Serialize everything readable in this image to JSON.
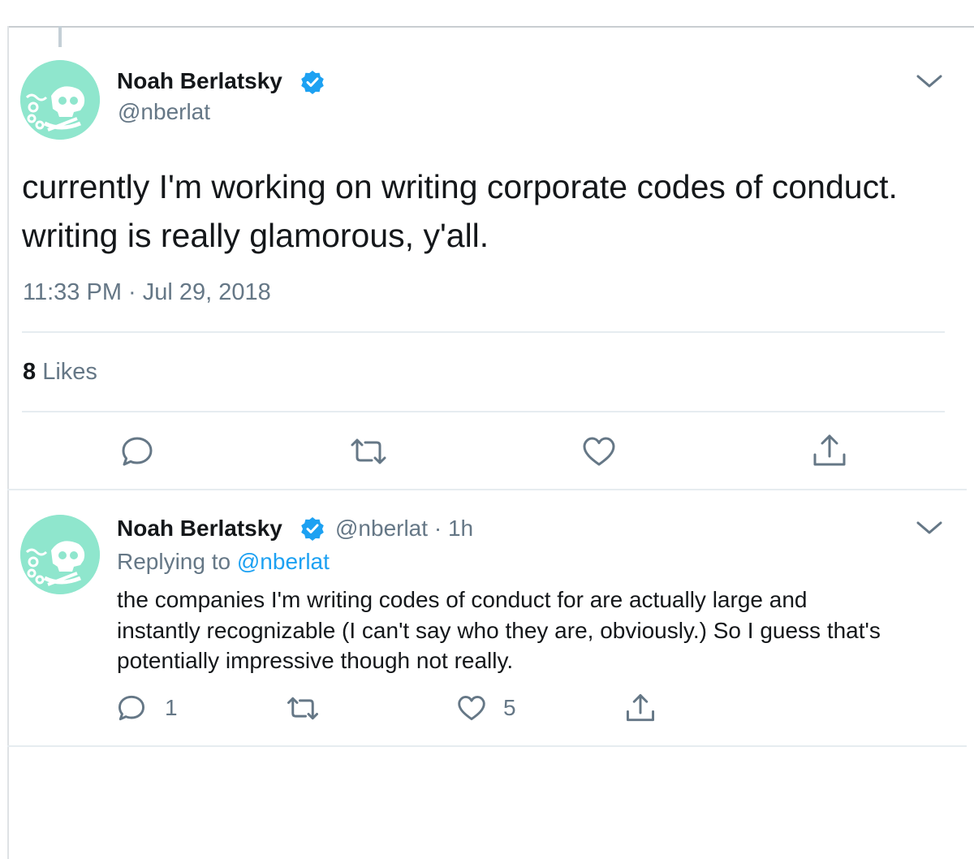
{
  "main_tweet": {
    "author_name": "Noah Berlatsky",
    "author_handle": "@nberlat",
    "text_lines": [
      "currently I'm working on writing corporate codes of conduct.",
      "writing is really glamorous, y'all."
    ],
    "time": "11:33 PM",
    "separator": "·",
    "date": "Jul 29, 2018",
    "likes_count": "8",
    "likes_label": "Likes"
  },
  "reply_tweet": {
    "author_name": "Noah Berlatsky",
    "author_handle": "@nberlat",
    "separator": "·",
    "age": "1h",
    "replying_prefix": "Replying to",
    "replying_to": "@nberlat",
    "text_lines": [
      "the companies I'm writing codes of conduct for are actually large and",
      "instantly recognizable (I can't say who they are, obviously.) So I guess that's",
      "potentially impressive though not really."
    ],
    "reply_count": "1",
    "like_count": "5"
  },
  "icons": {
    "avatar": "skull-avatar-icon",
    "verified": "verified-badge-icon",
    "menu": "chevron-down-icon",
    "reply": "reply-icon",
    "retweet": "retweet-icon",
    "like": "heart-icon",
    "share": "share-icon"
  },
  "colors": {
    "text": "#14171a",
    "secondary": "#657786",
    "accent": "#1da1f2",
    "avatar_bg": "#8fe6cd",
    "divider": "#e6ecf0"
  }
}
